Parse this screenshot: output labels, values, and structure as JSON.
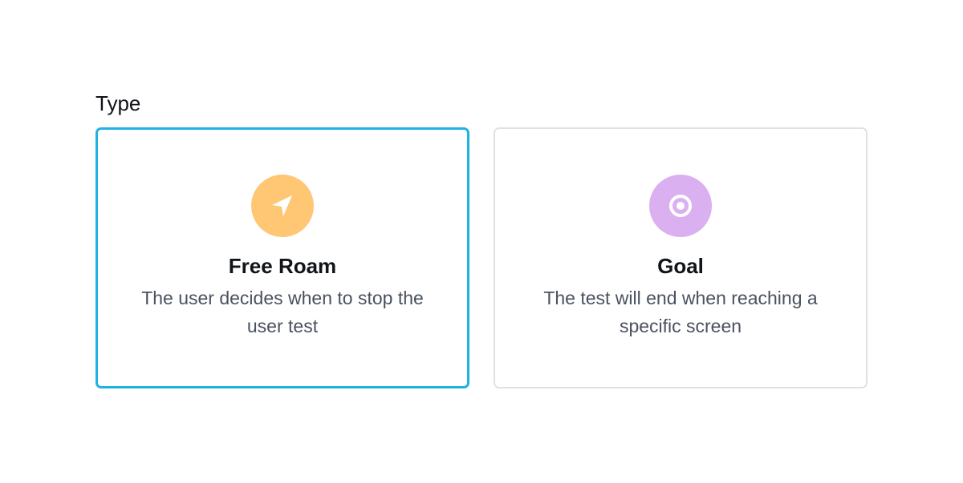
{
  "type_section": {
    "label": "Type",
    "options": [
      {
        "title": "Free Roam",
        "description": "The user decides when to stop the user test",
        "icon": "navigation-arrow-icon",
        "icon_color": "#ffc674",
        "selected": true
      },
      {
        "title": "Goal",
        "description": "The test will end when reaching a specific screen",
        "icon": "target-icon",
        "icon_color": "#dbb0f0",
        "selected": false
      }
    ]
  },
  "colors": {
    "selected_border": "#1fb3e4",
    "default_border": "#dfe1e6"
  }
}
